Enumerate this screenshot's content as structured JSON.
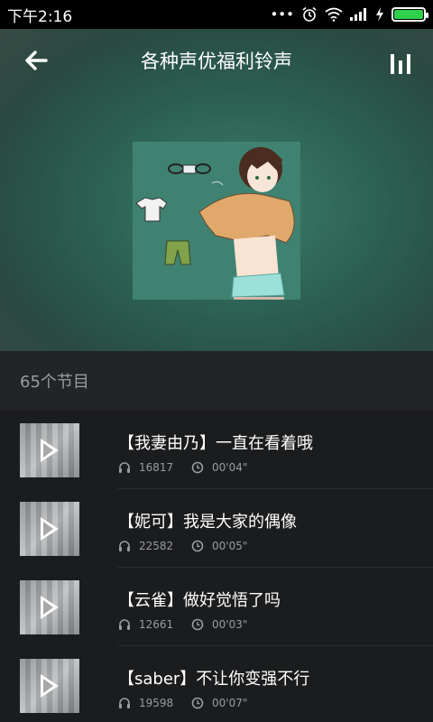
{
  "status_bar": {
    "time": "下午2:16",
    "icons": [
      "more-dots-icon",
      "alarm-icon",
      "wifi-icon",
      "signal-icon",
      "charging-icon",
      "battery-icon"
    ],
    "battery_color": "#2fd04b"
  },
  "header": {
    "title": "各种声优福利铃声",
    "back_icon": "arrow-left-icon",
    "playing_icon": "equalizer-icon"
  },
  "album": {
    "cover": "anime-boy-illustration"
  },
  "program_list": {
    "count_label": "65个节目",
    "items": [
      {
        "title": "【我妻由乃】一直在看着哦",
        "plays": "16817",
        "duration": "00'04\""
      },
      {
        "title": "【妮可】我是大家的偶像",
        "plays": "22582",
        "duration": "00'05\""
      },
      {
        "title": "【云雀】做好觉悟了吗",
        "plays": "12661",
        "duration": "00'03\""
      },
      {
        "title": "【saber】不让你变强不行",
        "plays": "19598",
        "duration": "00'07\""
      }
    ]
  },
  "colors": {
    "hero_accent": "#3c7e6c",
    "list_background": "#1b1c1e",
    "secondary_text": "#9a9ca0"
  }
}
